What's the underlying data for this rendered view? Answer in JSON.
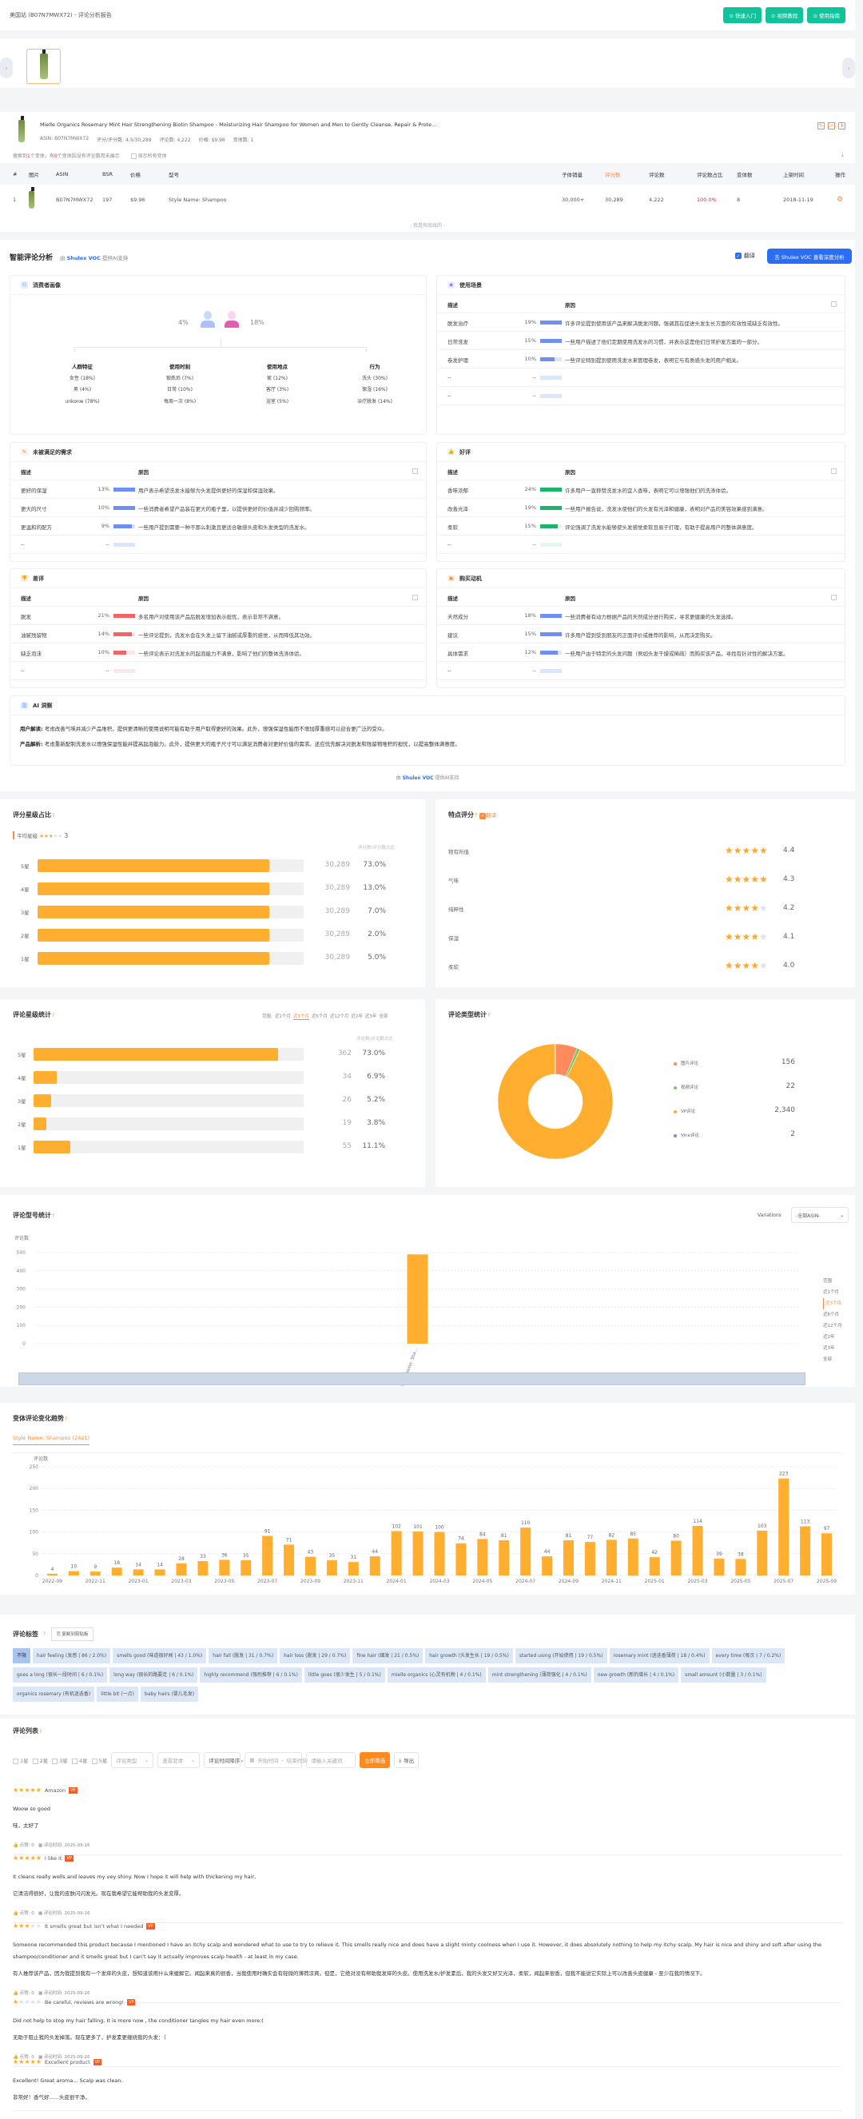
{
  "header": {
    "title": "美国站 (B07N7MWX72) - 评论分析报告",
    "buttons": [
      "⊙ 快速入门",
      "⊙ 视频教程",
      "⊙ 使用指南"
    ]
  },
  "carousel": {
    "prev": "‹",
    "next": "›"
  },
  "product": {
    "title": "Mielle Organics Rosemary Mint Hair Strengthening Biotin Shampoo - Moisturizing Hair Shampoo for Women and Men to Gently Cleanse, Repair & Prote...",
    "asin": "ASIN: B07N7MWX72",
    "rating": "评分/评分数: 4.5/30,289",
    "reviews": "评论数: 4,222",
    "price": "价格: $9.96",
    "variants": "变体数: 1",
    "note_pre": "搜索到",
    "note_n1": "1",
    "note_mid": "个变体，有",
    "note_n2": "0",
    "note_post": "个变体因没有评论数而未展示",
    "show_all": "显示所有变体",
    "columns": [
      "#",
      "图片",
      "ASIN",
      "BSR",
      "价格",
      "型号",
      "子体销量",
      "评分数",
      "评论数",
      "评论数占比",
      "变体数",
      "上架时间",
      "操作"
    ],
    "rows": [
      {
        "idx": "1",
        "asin": "B07N7MWX72",
        "bsr": "197",
        "price": "$9.96",
        "model": "Style Name: Shampoo",
        "sales": "30,000+",
        "ratings": "30,289",
        "reviews": "4,222",
        "share": "100.0%",
        "variants": "8",
        "date": "2018-11-19"
      }
    ],
    "no_more": "- 我是有底线的 -"
  },
  "ai": {
    "title": "智能评论分析",
    "by": "由",
    "brand": "Shulex VOC",
    "support": "提供AI支持",
    "translate": "翻译",
    "voc_button": "去 Shulex VOC 查看深度分析",
    "persona": {
      "title": "消费者画像",
      "male_pct": "4%",
      "female_pct": "18%",
      "cols": [
        {
          "title": "人群特征",
          "items": [
            "女性 (18%)",
            "男 (4%)",
            "unkonw (78%)"
          ]
        },
        {
          "title": "使用时刻",
          "items": [
            "锻炼后 (7%)",
            "日常 (10%)",
            "每周一次 (8%)"
          ]
        },
        {
          "title": "使用地点",
          "items": [
            "家 (12%)",
            "客厅 (3%)",
            "浴室 (5%)"
          ]
        },
        {
          "title": "行为",
          "items": [
            "洗头 (30%)",
            "保湿 (16%)",
            "治疗脱发 (14%)"
          ]
        }
      ]
    },
    "desc_label": "描述",
    "reason_label": "原因",
    "sections": [
      {
        "key": "scene",
        "title": "使用场景",
        "color": "#6f8ff5",
        "track": "#dbe5fb",
        "rows": [
          {
            "d": "脱发治疗",
            "p": "19%",
            "f": 1.0,
            "r": "许多评论提到使用该产品来解决脱发问题，强调其在促进头发生长方面的有效性或缺乏有效性。"
          },
          {
            "d": "日常洗发",
            "p": "15%",
            "f": 1.0,
            "r": "一些用户描述了他们定期使用洗发水的习惯，并表示这是他们日常护发方案的一部分。"
          },
          {
            "d": "卷发护理",
            "p": "10%",
            "f": 0.65,
            "r": "一些评论特别提到使用洗发水来管理卷发，表明它与有质感头发的用户相关。"
          },
          {
            "d": "--",
            "p": "--",
            "f": 0,
            "r": ""
          },
          {
            "d": "--",
            "p": "--",
            "f": 0,
            "r": ""
          }
        ]
      },
      {
        "key": "unmet",
        "title": "未被满足的需求",
        "color": "#6f8ff5",
        "track": "#dbe5fb",
        "rows": [
          {
            "d": "更好的保湿",
            "p": "13%",
            "f": 1.0,
            "r": "用户表示希望洗发水能够为头发提供更好的保湿和保湿效果。"
          },
          {
            "d": "更大的尺寸",
            "p": "10%",
            "f": 1.0,
            "r": "一些消费者希望产品装在更大的瓶子里，以提供更好的价值并减少回购频率。"
          },
          {
            "d": "更温和的配方",
            "p": "9%",
            "f": 0.85,
            "r": "一些用户提到需要一种不那么刺激且更适合敏感头皮和头发类型的洗发水。"
          },
          {
            "d": "--",
            "p": "--",
            "f": 0,
            "r": ""
          },
          {
            "d": "--",
            "p": "--",
            "f": 0,
            "r": ""
          }
        ]
      },
      {
        "key": "good",
        "title": "好评",
        "color": "#1db36b",
        "track": "#e3f7ec",
        "rows": [
          {
            "d": "香味浓郁",
            "p": "24%",
            "f": 1.0,
            "r": "许多用户一直称赞洗发水的宜人香味，表明它可以增强他们的洗涤体验。"
          },
          {
            "d": "改善光泽",
            "p": "19%",
            "f": 1.0,
            "r": "一些用户报告说，洗发水使他们的头发有光泽和健康，表明对产品的美容效果感到满意。"
          },
          {
            "d": "柔软",
            "p": "15%",
            "f": 0.8,
            "r": "评论强调了洗发水能够使头发感觉柔软且易于打理，有助于提高用户的整体满意度。"
          },
          {
            "d": "--",
            "p": "--",
            "f": 0,
            "r": ""
          },
          {
            "d": "--",
            "p": "--",
            "f": 0,
            "r": ""
          }
        ]
      },
      {
        "key": "bad",
        "title": "差评",
        "color": "#f56464",
        "track": "#fde6e6",
        "rows": [
          {
            "d": "脱发",
            "p": "21%",
            "f": 1.0,
            "r": "多名用户对使用该产品后脱发增加表示担忧，表示非常不满意。"
          },
          {
            "d": "油腻残留物",
            "p": "14%",
            "f": 0.85,
            "r": "一些评论提到，洗发水会在头发上留下油腻或厚重的感觉，从而降低其功效。"
          },
          {
            "d": "缺乏泡沫",
            "p": "10%",
            "f": 0.6,
            "r": "一些评论表示对洗发水的起泡能力不满意，影响了他们的整体洗涤体验。"
          },
          {
            "d": "--",
            "p": "--",
            "f": 0,
            "r": ""
          },
          {
            "d": "--",
            "p": "--",
            "f": 0,
            "r": ""
          }
        ]
      },
      {
        "key": "motive",
        "title": "购买动机",
        "color": "#6f8ff5",
        "track": "#dbe5fb",
        "rows": [
          {
            "d": "天然成分",
            "p": "18%",
            "f": 1.0,
            "r": "一些消费者有动力根据产品的天然成分进行购买，寻求更健康的头发选择。"
          },
          {
            "d": "建议",
            "p": "15%",
            "f": 1.0,
            "r": "许多用户提到受到朋友的正面评价或推荐的影响，从而决定购买。"
          },
          {
            "d": "具体需求",
            "p": "12%",
            "f": 0.8,
            "r": "一些用户由于特定的头发问题（例如头发干燥或稀疏）而购买该产品，寻找有针对性的解决方案。"
          },
          {
            "d": "--",
            "p": "--",
            "f": 0,
            "r": ""
          },
          {
            "d": "--",
            "p": "--",
            "f": 0,
            "r": ""
          }
        ]
      }
    ],
    "insight": {
      "title": "AI 洞察",
      "user_label": "用户解读:",
      "user_text": "考虑改善气味并减少产品堆积，提供更清晰的使用说明可能有助于用户取得更好的效果。此外，增强保湿性能而不增加厚重感可以迎合更广泛的受众。",
      "product_label": "产品解析:",
      "product_text": "考虑重新配制洗发水以增强保湿性能并提高起泡能力。此外，提供更大的瓶子尺寸可以满足消费者对更好价值的需求。还应优先解决对脱发和残留物堆积的担忧，以提高整体满意度。"
    }
  },
  "rating_share": {
    "title": "评分星级占比",
    "avg_label": "平均星级",
    "avg_stars": 3,
    "avg_value": "3",
    "col_header": "评分数/评分数占比",
    "rows": [
      {
        "label": "5星",
        "count": "30,289",
        "pct": "73.0%",
        "fill": 0.87
      },
      {
        "label": "4星",
        "count": "30,289",
        "pct": "13.0%",
        "fill": 0.87
      },
      {
        "label": "3星",
        "count": "30,289",
        "pct": "7.0%",
        "fill": 0.87
      },
      {
        "label": "2星",
        "count": "30,289",
        "pct": "2.0%",
        "fill": 0.87
      },
      {
        "label": "1星",
        "count": "30,289",
        "pct": "5.0%",
        "fill": 0.87
      }
    ]
  },
  "feature_score": {
    "title": "特点评分",
    "translate": "翻译",
    "rows": [
      {
        "label": "物有所值",
        "score": 4.4,
        "text": "4.4"
      },
      {
        "label": "气味",
        "score": 4.3,
        "text": "4.3"
      },
      {
        "label": "纯粹性",
        "score": 4.2,
        "text": "4.2"
      },
      {
        "label": "保湿",
        "score": 4.1,
        "text": "4.1"
      },
      {
        "label": "柔软",
        "score": 4.0,
        "text": "4.0"
      }
    ]
  },
  "review_stars": {
    "title": "评论星级统计",
    "range_label": "范围:",
    "ranges": [
      "近1个月",
      "近3个月",
      "近6个月",
      "近12个月",
      "近2年",
      "近3年",
      "全部"
    ],
    "active_range": 1,
    "col_header": "评论数/评论数占比",
    "rows": [
      {
        "label": "5星",
        "count": "362",
        "pct": "73.0%",
        "fill": 0.905
      },
      {
        "label": "4星",
        "count": "34",
        "pct": "6.9%",
        "fill": 0.085
      },
      {
        "label": "3星",
        "count": "26",
        "pct": "5.2%",
        "fill": 0.065
      },
      {
        "label": "2星",
        "count": "19",
        "pct": "3.8%",
        "fill": 0.048
      },
      {
        "label": "1星",
        "count": "55",
        "pct": "11.1%",
        "fill": 0.137
      }
    ]
  },
  "review_type": {
    "title": "评论类型统计",
    "colors": [
      "#ff8a5b",
      "#7cc66b",
      "#ffae2f",
      "#7b83f7"
    ],
    "items": [
      {
        "label": "图片评论",
        "value": 156,
        "text": "156"
      },
      {
        "label": "视频评论",
        "value": 22,
        "text": "22"
      },
      {
        "label": "VP评论",
        "value": 2340,
        "text": "2,340"
      },
      {
        "label": "Vine评论",
        "value": 2,
        "text": "2"
      }
    ]
  },
  "chart_data": [
    {
      "type": "bar",
      "title": "评论型号统计",
      "ylabel": "评论数",
      "ylim": [
        0,
        500
      ],
      "yticks": [
        0,
        100,
        200,
        300,
        400,
        500
      ],
      "categories": [
        "Style Name: Sha..."
      ],
      "values": [
        490
      ],
      "grid": true,
      "variations_label": "Variations",
      "variations_value": "-全部ASIN-",
      "range_label": "范围",
      "ranges": [
        "近1个月",
        "近3个月",
        "近6个月",
        "近12个月",
        "近2年",
        "近3年",
        "全部"
      ],
      "active_range": 1
    },
    {
      "type": "bar",
      "title": "变体评论变化趋势",
      "tab": "Style Name: Shampoo (2421)",
      "ylabel": "评论数",
      "ylim": [
        0,
        250
      ],
      "yticks": [
        0,
        50,
        100,
        150,
        200,
        250
      ],
      "grid": true,
      "categories": [
        "2022-09",
        "2022-10",
        "2022-11",
        "2022-12",
        "2023-01",
        "2023-02",
        "2023-03",
        "2023-04",
        "2023-05",
        "2023-06",
        "2023-07",
        "2023-08",
        "2023-09",
        "2023-10",
        "2023-11",
        "2023-12",
        "2024-01",
        "2024-02",
        "2024-03",
        "2024-04",
        "2024-05",
        "2024-06",
        "2024-07",
        "2024-08",
        "2024-09",
        "2024-10",
        "2024-11",
        "2024-12",
        "2025-01",
        "2025-02",
        "2025-03",
        "2025-04",
        "2025-05",
        "2025-06",
        "2025-07",
        "2025-08",
        "2025-09"
      ],
      "values": [
        4,
        10,
        9,
        18,
        14,
        14,
        28,
        33,
        36,
        35,
        91,
        71,
        43,
        35,
        31,
        44,
        102,
        101,
        100,
        74,
        84,
        81,
        110,
        44,
        81,
        77,
        82,
        85,
        42,
        80,
        114,
        39,
        38,
        103,
        223,
        113,
        97
      ]
    }
  ],
  "tags": {
    "title": "评论标签",
    "copy_button": "复制到剪贴板",
    "items": [
      "不限",
      "hair feeling (发感 | 86 / 2.0%)",
      "smells good (味道很好闻 | 43 / 1.0%)",
      "hair fall (脱发 | 31 / 0.7%)",
      "hair loss (脱发 | 29 / 0.7%)",
      "fine hair (细发 | 21 / 0.5%)",
      "hair growth (头发生长 | 19 / 0.5%)",
      "started using (开始使用 | 19 / 0.5%)",
      "rosemary mint (迷迭香薄荷 | 18 / 0.4%)",
      "every time (每次 | 7 / 0.2%)",
      "goes a long (很长一段时间 | 6 / 0.1%)",
      "long way (很长的路要走 | 6 / 0.1%)",
      "highly recommend (强烈推荐 | 6 / 0.1%)",
      "little goes (很少发生 | 5 / 0.1%)",
      "mielle organics (心灵有机物 | 4 / 0.1%)",
      "mint strengthening (薄荷强化 | 4 / 0.1%)",
      "new growth (新的增长 | 4 / 0.1%)",
      "small amount (小数量 | 3 / 0.1%)",
      "organics rosemary (有机迷迭香)",
      "little bit (一点)",
      "baby hairs (婴儿毛发)"
    ]
  },
  "review_list": {
    "title": "评论列表",
    "star_filters": [
      "1星",
      "2星",
      "3星",
      "4星",
      "5星"
    ],
    "type_placeholder": "评论类型",
    "variant_placeholder": "查看变体",
    "sort_value": "评论时间降序",
    "start_placeholder": "开始时间",
    "end_placeholder": "结束时间",
    "keyword_placeholder": "请输入关键词",
    "filter_button": "立即筛选",
    "export_button": "导出",
    "vp_badge": "VP",
    "likes_label": "点赞: 0",
    "time_label": "评论时间: 2025-09-16",
    "reviews": [
      {
        "stars": 5,
        "title": "Amazon",
        "text": "Woow so good",
        "translation": "哇，太好了"
      },
      {
        "stars": 5,
        "title": "I like it",
        "text": "It cleans really wells and leaves my vey shiny. Now I hope it will help with thickening my hair,",
        "translation": "它清洁得很好，让我的皮肤闪闪发光。现在我希望它能帮助我的头发变厚。"
      },
      {
        "stars": 3,
        "title": "It smells great but isn't what I needed",
        "text": "Someone recommended this product because I mentioned I have an itchy scalp and wondered what to use to try to relieve it. This smells really nice and does have a slight minty coolness when I use it. However, it does absolutely nothing to help my itchy scalp. My hair is nice and shiny and soft after using the shampoo/conditioner and it smells great but I can't say it actually improves scalp health - at least in my case.",
        "translation": "有人推荐该产品，因为我提到我有一个发痒的头皮，想知道该用什么来缓解它。闻起来真的很香，当我使用时确实会有轻微的薄荷凉爽。但是，它绝对没有帮助我发痒的头皮。使用洗发水/护发素后，我的头发又好又光泽，柔软，闻起来很香，但我不能说它实际上可以改善头皮健康 - 至少在我的情况下。"
      },
      {
        "stars": 1,
        "title": "Be careful, reviews are wrong!",
        "text": "Did not help to stop my hair falling. It is more now , the conditioner tangles my hair even more:(",
        "translation": "无助于阻止我的头发掉落。现在更多了，护发素更缠绕我的头发：（"
      },
      {
        "stars": 5,
        "title": "Excellent product",
        "text": "Excellent! Great aroma... Scalp was clean.",
        "translation": "非常好！香气好......头皮很干净。"
      }
    ]
  }
}
